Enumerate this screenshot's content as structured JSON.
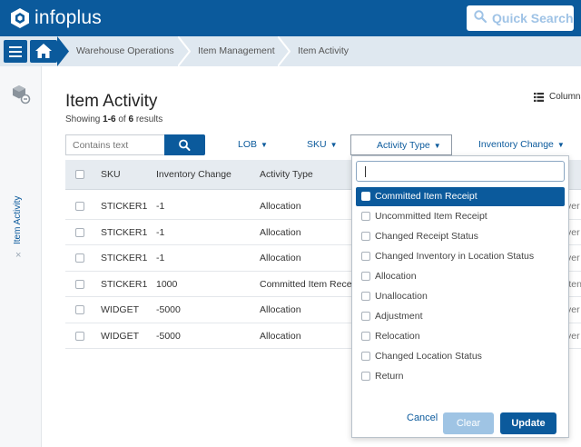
{
  "app": {
    "logo_text": "infoplus",
    "quick_search_placeholder": "Quick Search",
    "colors": {
      "brand": "#0b5a9c",
      "crumb_bg": "#dfe8f0",
      "header_bg": "#e6ebf0",
      "clear_btn": "#9fc4e4"
    }
  },
  "breadcrumb": {
    "items": [
      "Warehouse Operations",
      "Item Management",
      "Item Activity"
    ]
  },
  "rail": {
    "label": "Item Activity",
    "close": "×",
    "icon": "boxes-icon"
  },
  "page": {
    "title": "Item Activity",
    "showing_prefix": "Showing ",
    "showing_range": "1-6",
    "showing_of": " of ",
    "showing_total": "6",
    "showing_suffix": " results",
    "columns_label": "Columns"
  },
  "toolbar": {
    "search_placeholder": "Contains text",
    "filters": {
      "lob": "LOB",
      "sku": "SKU",
      "activity_type": "Activity Type",
      "inventory_change": "Inventory Change"
    }
  },
  "table": {
    "headers": {
      "sku": "SKU",
      "inventory_change": "Inventory Change",
      "activity_type": "Activity Type"
    },
    "rows": [
      {
        "sku": "STICKER1",
        "change": "-1",
        "type": "Allocation",
        "tail": "ver"
      },
      {
        "sku": "STICKER1",
        "change": "-1",
        "type": "Allocation",
        "tail": "ver"
      },
      {
        "sku": "STICKER1",
        "change": "-1",
        "type": "Allocation",
        "tail": "ver"
      },
      {
        "sku": "STICKER1",
        "change": "1000",
        "type": "Committed Item Receipt",
        "tail": "lten"
      },
      {
        "sku": "WIDGET",
        "change": "-5000",
        "type": "Allocation",
        "tail": "ver"
      },
      {
        "sku": "WIDGET",
        "change": "-5000",
        "type": "Allocation",
        "tail": "ver"
      }
    ]
  },
  "dropdown": {
    "search_value": "",
    "options": [
      "Committed Item Receipt",
      "Uncommitted Item Receipt",
      "Changed Receipt Status",
      "Changed Inventory in Location Status",
      "Allocation",
      "Unallocation",
      "Adjustment",
      "Relocation",
      "Changed Location Status",
      "Return"
    ],
    "highlighted_index": 0,
    "cancel_label": "Cancel",
    "clear_label": "Clear",
    "update_label": "Update"
  }
}
